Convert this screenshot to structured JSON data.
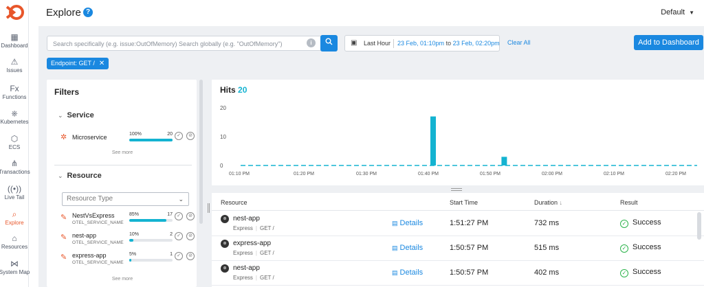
{
  "nav": {
    "items": [
      {
        "label": "Dashboard",
        "icon": "grid-icon",
        "glyph": "▦"
      },
      {
        "label": "Issues",
        "icon": "warning-icon",
        "glyph": "⚠"
      },
      {
        "label": "Functions",
        "icon": "fx-icon",
        "glyph": "Fx"
      },
      {
        "label": "Kubernetes",
        "icon": "helm-icon",
        "glyph": "⎈"
      },
      {
        "label": "ECS",
        "icon": "container-icon",
        "glyph": "⬡"
      },
      {
        "label": "Transactions",
        "icon": "flow-icon",
        "glyph": "⋔"
      },
      {
        "label": "Live Tail",
        "icon": "broadcast-icon",
        "glyph": "((•))"
      },
      {
        "label": "Explore",
        "icon": "search-icon",
        "glyph": "⌕"
      },
      {
        "label": "Resources",
        "icon": "home-icon",
        "glyph": "⌂"
      },
      {
        "label": "System Map",
        "icon": "network-icon",
        "glyph": "⋈"
      }
    ],
    "active": "Explore"
  },
  "header": {
    "title": "Explore",
    "help": "?",
    "account": "Default"
  },
  "toolbar": {
    "search_placeholder": "Search specifically (e.g. issue:OutOfMemory) Search globally (e.g. \"OutOfMemory\")",
    "info": "i",
    "range_label": "Last Hour",
    "range_from": "23 Feb, 01:10pm",
    "range_to_word": "to",
    "range_to": "23 Feb, 02:20pm",
    "clear_all": "Clear All",
    "add_dashboard": "Add to Dashboard"
  },
  "chip": {
    "label": "Endpoint: GET /",
    "close": "✕"
  },
  "filters": {
    "title": "Filters",
    "service_section": "Service",
    "services": [
      {
        "name": "Microservice",
        "percent": "100%",
        "count": "20",
        "fraction": 1.0
      }
    ],
    "see_more": "See more",
    "resource_section": "Resource",
    "resource_type_placeholder": "Resource Type",
    "resources": [
      {
        "name": "NestVsExpress",
        "sub": "OTEL_SERVICE_NAME",
        "percent": "85%",
        "count": "17",
        "fraction": 0.85
      },
      {
        "name": "nest-app",
        "sub": "OTEL_SERVICE_NAME",
        "percent": "10%",
        "count": "2",
        "fraction": 0.1
      },
      {
        "name": "express-app",
        "sub": "OTEL_SERVICE_NAME",
        "percent": "5%",
        "count": "1",
        "fraction": 0.05
      }
    ]
  },
  "hits": {
    "label": "Hits",
    "count": "20"
  },
  "chart_data": {
    "type": "bar",
    "title": "Hits",
    "xlabel": "",
    "ylabel": "",
    "ylim": [
      0,
      20
    ],
    "yticks": [
      "20",
      "10",
      "0"
    ],
    "xticks": [
      "01:10 PM",
      "01:20 PM",
      "01:30 PM",
      "01:40 PM",
      "01:50 PM",
      "02:00 PM",
      "02:10 PM",
      "02:20 PM"
    ],
    "bars": [
      {
        "x": "01:40 PM",
        "value": 17
      },
      {
        "x": "01:51 PM",
        "value": 3
      }
    ],
    "color": "#14b3d1"
  },
  "table": {
    "columns": [
      "Resource",
      "Start Time",
      "Duration",
      "Result"
    ],
    "sort_indicator": "↓",
    "details_label": "Details",
    "rows": [
      {
        "name": "nest-app",
        "framework": "Express",
        "route": "GET /",
        "start": "1:51:27 PM",
        "duration": "732 ms",
        "result": "Success"
      },
      {
        "name": "express-app",
        "framework": "Express",
        "route": "GET /",
        "start": "1:50:57 PM",
        "duration": "515 ms",
        "result": "Success"
      },
      {
        "name": "nest-app",
        "framework": "Express",
        "route": "GET /",
        "start": "1:50:57 PM",
        "duration": "402 ms",
        "result": "Success"
      }
    ]
  }
}
